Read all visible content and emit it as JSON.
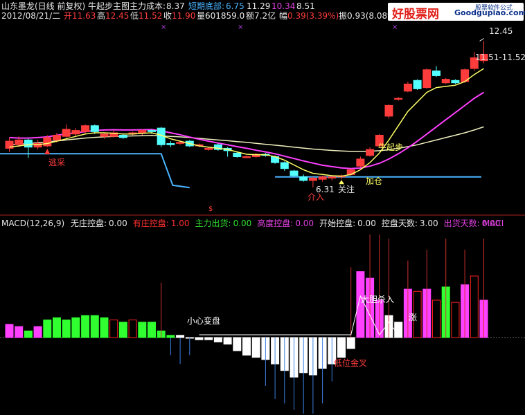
{
  "header": {
    "title": "山东墨龙(日线 前复权) 牛起步主图",
    "main_cost_label": "主力成本:",
    "main_cost": "8.37",
    "short_bottom_label": "短期底部:",
    "short_bottom": "6.75",
    "v1": "11.29",
    "v2": "10.34",
    "v3": "8.51",
    "date": "2012/08/21/二",
    "open_label": "开",
    "open": "11.63",
    "high_label": "高",
    "high": "12.45",
    "low_label": "低",
    "low": "11.52",
    "close_label": "收",
    "close": "11.90",
    "vol_label": "量",
    "vol": "601859.0",
    "amt_label": "额",
    "amt": "7.2亿",
    "chg_label": "幅",
    "chg": "0.39(3.39%)",
    "amp_label": "振",
    "amp": "0.93(8.08%)",
    "turn_label": "换",
    "turn": "4"
  },
  "watermark": {
    "site": "好股票网",
    "domain": "Goodgupiao.com",
    "soft": "股票软件公式"
  },
  "price_annotations": {
    "high_mark": "12.45",
    "range": "11.51-11.52",
    "low_mark": "6.31",
    "guanzhu": "关注",
    "jiacang": "加仓",
    "jieru": "介入",
    "niuqibu": "牛起步",
    "dunshou": "逃采",
    "dollar": "$"
  },
  "indicator_bar": {
    "macd": "MACD(12,26,9)",
    "items": [
      {
        "label": "无庄控盘:",
        "value": "0.00",
        "color": "#e8e8e8"
      },
      {
        "label": "有庄控盘:",
        "value": "1.00",
        "color": "#ff3030"
      },
      {
        "label": "主力出货:",
        "value": "0.00",
        "color": "#30e030"
      },
      {
        "label": "高度控盘:",
        "value": "0.00",
        "color": "#e040e0"
      },
      {
        "label": "开始控盘:",
        "value": "0.00",
        "color": "#e8e8e8"
      },
      {
        "label": "控盘天数:",
        "value": "3.00",
        "color": "#e8e8e8"
      },
      {
        "label": "出货天数:",
        "value": "0.00",
        "color": "#e040e0"
      }
    ],
    "maci": "MACI"
  },
  "macd_annotations": {
    "xiaoxin": "小心变盘",
    "dadan": "大胆杀入",
    "dizhi": "低位金叉",
    "zhang": "涨"
  },
  "colors": {
    "up": "#ff3c3c",
    "down": "#54ffff",
    "ma1": "#ffff66",
    "ma2": "#ff40ff",
    "ma3": "#f0f0c0",
    "hline": "#4ab4ff"
  },
  "price_axis": {
    "min": 5.9,
    "max": 12.9
  },
  "candles": [
    {
      "o": 7.95,
      "c": 8.25,
      "h": 8.4,
      "l": 7.8
    },
    {
      "o": 8.1,
      "c": 8.3,
      "h": 8.45,
      "l": 8.0
    },
    {
      "o": 8.3,
      "c": 8.0,
      "h": 8.35,
      "l": 7.55
    },
    {
      "o": 8.0,
      "c": 8.15,
      "h": 8.3,
      "l": 7.9
    },
    {
      "o": 8.05,
      "c": 8.4,
      "h": 8.5,
      "l": 8.0
    },
    {
      "o": 8.3,
      "c": 8.5,
      "h": 8.6,
      "l": 8.2
    },
    {
      "o": 8.45,
      "c": 8.75,
      "h": 8.95,
      "l": 8.4
    },
    {
      "o": 8.55,
      "c": 8.7,
      "h": 8.8,
      "l": 8.45
    },
    {
      "o": 8.65,
      "c": 8.9,
      "h": 8.95,
      "l": 8.55
    },
    {
      "o": 8.9,
      "c": 8.65,
      "h": 8.95,
      "l": 8.55
    },
    {
      "o": 8.45,
      "c": 8.55,
      "h": 8.6,
      "l": 8.35
    },
    {
      "o": 8.45,
      "c": 8.6,
      "h": 8.7,
      "l": 8.4
    },
    {
      "o": 8.5,
      "c": 8.4,
      "h": 8.55,
      "l": 8.35
    },
    {
      "o": 8.55,
      "c": 8.6,
      "h": 8.65,
      "l": 8.5
    },
    {
      "o": 8.6,
      "c": 8.7,
      "h": 8.75,
      "l": 8.5
    },
    {
      "o": 8.7,
      "c": 8.65,
      "h": 8.75,
      "l": 8.55
    },
    {
      "o": 8.8,
      "c": 8.1,
      "h": 8.85,
      "l": 8.0
    },
    {
      "o": 8.15,
      "c": 8.1,
      "h": 8.25,
      "l": 8.0
    },
    {
      "o": 8.2,
      "c": 8.2,
      "h": 8.25,
      "l": 8.1
    },
    {
      "o": 8.25,
      "c": 8.05,
      "h": 8.3,
      "l": 8.0
    },
    {
      "o": 8.05,
      "c": 8.1,
      "h": 8.15,
      "l": 8.0
    },
    {
      "o": 7.9,
      "c": 7.95,
      "h": 8.0,
      "l": 7.85
    },
    {
      "o": 8.1,
      "c": 7.9,
      "h": 8.15,
      "l": 7.85
    },
    {
      "o": 7.95,
      "c": 7.85,
      "h": 8.0,
      "l": 7.6
    },
    {
      "o": 7.75,
      "c": 7.6,
      "h": 7.8,
      "l": 7.55
    },
    {
      "o": 7.6,
      "c": 7.6,
      "h": 7.65,
      "l": 7.55
    },
    {
      "o": 7.6,
      "c": 7.7,
      "h": 7.75,
      "l": 7.55
    },
    {
      "o": 7.7,
      "c": 7.65,
      "h": 7.75,
      "l": 7.6
    },
    {
      "o": 7.6,
      "c": 7.35,
      "h": 7.65,
      "l": 7.3
    },
    {
      "o": 7.35,
      "c": 7.1,
      "h": 7.4,
      "l": 7.0
    },
    {
      "o": 7.0,
      "c": 6.8,
      "h": 7.05,
      "l": 6.75
    },
    {
      "o": 6.75,
      "c": 6.6,
      "h": 6.85,
      "l": 6.55
    },
    {
      "o": 6.6,
      "c": 6.7,
      "h": 6.75,
      "l": 6.31
    },
    {
      "o": 6.65,
      "c": 6.75,
      "h": 6.8,
      "l": 6.55
    },
    {
      "o": 6.7,
      "c": 6.75,
      "h": 6.8,
      "l": 6.6
    },
    {
      "o": 6.75,
      "c": 6.8,
      "h": 6.85,
      "l": 6.65
    },
    {
      "o": 6.85,
      "c": 7.05,
      "h": 7.1,
      "l": 6.8
    },
    {
      "o": 7.2,
      "c": 7.5,
      "h": 7.6,
      "l": 7.15
    },
    {
      "o": 7.65,
      "c": 7.9,
      "h": 8.0,
      "l": 7.6
    },
    {
      "o": 8.05,
      "c": 8.5,
      "h": 8.55,
      "l": 8.0
    },
    {
      "o": 9.3,
      "c": 9.75,
      "h": 9.8,
      "l": 9.2
    },
    {
      "o": 10.05,
      "c": 10.05,
      "h": 10.1,
      "l": 9.95
    },
    {
      "o": 10.35,
      "c": 10.65,
      "h": 10.75,
      "l": 10.3
    },
    {
      "o": 10.8,
      "c": 10.45,
      "h": 10.85,
      "l": 10.4
    },
    {
      "o": 10.5,
      "c": 11.25,
      "h": 11.3,
      "l": 10.45
    },
    {
      "o": 11.2,
      "c": 11.0,
      "h": 11.4,
      "l": 10.95
    },
    {
      "o": 10.7,
      "c": 10.85,
      "h": 10.9,
      "l": 10.65
    },
    {
      "o": 10.8,
      "c": 10.7,
      "h": 10.85,
      "l": 10.65
    },
    {
      "o": 10.75,
      "c": 11.25,
      "h": 11.3,
      "l": 10.7
    },
    {
      "o": 11.3,
      "c": 11.75,
      "h": 12.0,
      "l": 11.2
    },
    {
      "o": 11.63,
      "c": 11.9,
      "h": 12.45,
      "l": 11.52
    }
  ],
  "ma1": [
    8.0,
    8.05,
    8.1,
    8.1,
    8.15,
    8.25,
    8.35,
    8.45,
    8.55,
    8.6,
    8.6,
    8.58,
    8.55,
    8.55,
    8.58,
    8.6,
    8.5,
    8.35,
    8.25,
    8.15,
    8.05,
    8.0,
    7.95,
    7.9,
    7.8,
    7.7,
    7.68,
    7.68,
    7.6,
    7.45,
    7.25,
    7.05,
    6.9,
    6.85,
    6.8,
    6.78,
    6.85,
    7.05,
    7.35,
    7.75,
    8.3,
    8.9,
    9.5,
    9.9,
    10.3,
    10.5,
    10.55,
    10.6,
    10.75,
    11.05,
    11.3
  ],
  "ma2": [
    8.4,
    8.38,
    8.38,
    8.4,
    8.43,
    8.5,
    8.55,
    8.6,
    8.65,
    8.7,
    8.72,
    8.73,
    8.72,
    8.72,
    8.73,
    8.74,
    8.68,
    8.6,
    8.52,
    8.42,
    8.33,
    8.25,
    8.17,
    8.1,
    8.02,
    7.95,
    7.87,
    7.8,
    7.72,
    7.62,
    7.52,
    7.42,
    7.33,
    7.24,
    7.18,
    7.13,
    7.1,
    7.12,
    7.2,
    7.32,
    7.5,
    7.72,
    7.97,
    8.25,
    8.55,
    8.85,
    9.15,
    9.45,
    9.75,
    10.05,
    10.3
  ],
  "ma3": [
    8.1,
    8.12,
    8.15,
    8.18,
    8.22,
    8.26,
    8.3,
    8.34,
    8.38,
    8.41,
    8.43,
    8.45,
    8.46,
    8.47,
    8.48,
    8.49,
    8.47,
    8.45,
    8.43,
    8.4,
    8.37,
    8.33,
    8.3,
    8.27,
    8.23,
    8.2,
    8.16,
    8.12,
    8.08,
    8.04,
    8.0,
    7.96,
    7.92,
    7.89,
    7.86,
    7.84,
    7.82,
    7.82,
    7.83,
    7.85,
    7.89,
    7.95,
    8.02,
    8.1,
    8.2,
    8.3,
    8.4,
    8.5,
    8.6,
    8.72,
    8.85
  ],
  "hline": [
    {
      "from": 0,
      "to": 16,
      "v": 7.72
    },
    {
      "from": 17,
      "to": 50,
      "v": 6.75
    }
  ],
  "macd_axis": {
    "min": -0.45,
    "max": 0.45
  },
  "macd": [
    0.06,
    0.05,
    0.03,
    0.05,
    0.08,
    0.09,
    0.08,
    0.09,
    0.1,
    0.1,
    0.09,
    0.08,
    0.07,
    0.08,
    0.07,
    0.07,
    0.03,
    0.01,
    0.01,
    0.0,
    -0.01,
    -0.01,
    -0.02,
    -0.03,
    -0.06,
    -0.08,
    -0.09,
    -0.1,
    -0.12,
    -0.15,
    -0.18,
    -0.16,
    -0.17,
    -0.14,
    -0.12,
    -0.09,
    -0.05,
    0.3,
    0.27,
    0.17,
    0.1,
    0.07,
    0.22,
    0.21,
    0.22,
    0.17,
    0.23,
    0.16,
    0.24,
    0.28,
    0.17
  ],
  "macd_colors": [
    "M",
    "M",
    "G",
    "M",
    "G",
    "G",
    "G",
    "G",
    "G",
    "G",
    "G",
    "R",
    "G",
    "R",
    "G",
    "G",
    "G",
    "G",
    "W",
    "W",
    "W",
    "W",
    "W",
    "W",
    "W",
    "W",
    "W",
    "W",
    "W",
    "W",
    "W",
    "W",
    "W",
    "W",
    "W",
    "W",
    "W",
    "M",
    "M",
    "M",
    "W",
    "W",
    "M",
    "R",
    "M",
    "R",
    "G",
    "R",
    "M",
    "R",
    "M"
  ]
}
